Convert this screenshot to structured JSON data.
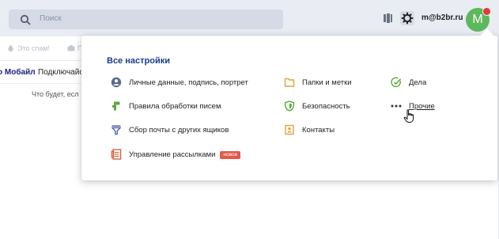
{
  "header": {
    "search_placeholder": "Поиск",
    "user_email": "m@b2br.ru",
    "avatar_letter": "M",
    "colors": {
      "bg": "#e9ecf3",
      "avatar": "#5cb85c",
      "notify": "#e53935"
    }
  },
  "toolbar": {
    "spam_label": "Это спам!",
    "read_label": "П"
  },
  "mail": {
    "sender": "о Мобайл",
    "subject": "Подключайс",
    "snippet": "Что будет, есл"
  },
  "settings_menu": {
    "title": "Все настройки",
    "items": [
      {
        "label": "Личные данные, подпись, портрет",
        "icon": "person-icon"
      },
      {
        "label": "Правила обработки писем",
        "icon": "rules-icon"
      },
      {
        "label": "Сбор почты с других ящиков",
        "icon": "filter-icon"
      },
      {
        "label": "Управление рассылками",
        "icon": "newsletter-icon",
        "badge": "новое"
      },
      {
        "label": "Папки и метки",
        "icon": "folder-icon"
      },
      {
        "label": "Безопасность",
        "icon": "shield-icon"
      },
      {
        "label": "Контакты",
        "icon": "contacts-icon"
      },
      {
        "label": "Дела",
        "icon": "check-icon"
      },
      {
        "label": "Прочие",
        "icon": "more-icon"
      }
    ],
    "colors": {
      "title": "#1a3c8c",
      "badge": "#e05a4b"
    }
  }
}
